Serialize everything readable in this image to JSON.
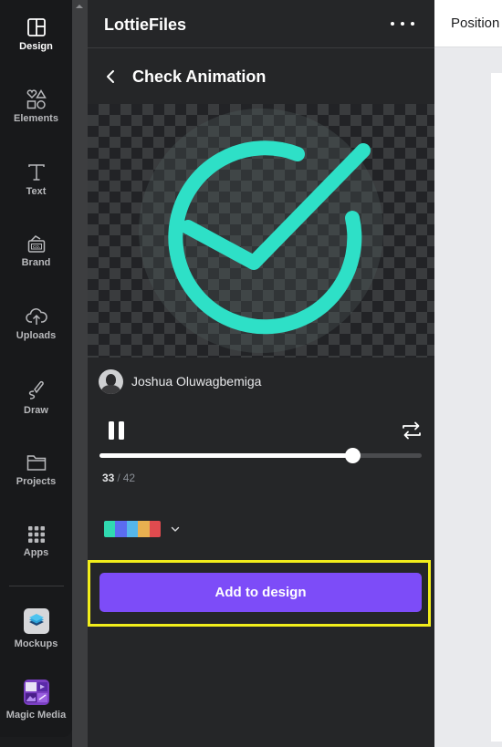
{
  "nav": {
    "items": [
      {
        "label": "Design",
        "icon": "layout-icon",
        "active": true
      },
      {
        "label": "Elements",
        "icon": "shapes-icon",
        "active": false
      },
      {
        "label": "Text",
        "icon": "text-icon",
        "active": false
      },
      {
        "label": "Brand",
        "icon": "brand-kit-icon",
        "active": false
      },
      {
        "label": "Uploads",
        "icon": "cloud-upload-icon",
        "active": false
      },
      {
        "label": "Draw",
        "icon": "pen-icon",
        "active": false
      },
      {
        "label": "Projects",
        "icon": "folder-icon",
        "active": false
      },
      {
        "label": "Apps",
        "icon": "apps-grid-icon",
        "active": false
      },
      {
        "label": "Mockups",
        "icon": "mockups-app-icon",
        "active": false
      },
      {
        "label": "Magic Media",
        "icon": "magic-media-app-icon",
        "active": false
      }
    ]
  },
  "panel": {
    "title": "LottieFiles",
    "more_icon": "more-horizontal-icon",
    "back_icon": "chevron-left-icon",
    "animation_title": "Check Animation",
    "preview": {
      "stroke_color": "#2ee0c7",
      "description": "circle with check mark"
    },
    "author": {
      "name": "Joshua Oluwagbemiga"
    },
    "player": {
      "state": "playing",
      "pause_icon": "pause-icon",
      "loop_icon": "loop-icon",
      "current_frame": "33",
      "separator": "/",
      "total_frames": "42",
      "progress_fraction": 0.786
    },
    "palette": {
      "colors": [
        "#30d9b0",
        "#5b6cf0",
        "#55b6ea",
        "#e8b050",
        "#e04b4f"
      ],
      "chevron_icon": "chevron-down-icon"
    },
    "add_button": "Add to design"
  },
  "canvas": {
    "toolbar_label": "Position"
  },
  "colors": {
    "accent": "#7d4cf8",
    "highlight": "#f2ee1b"
  }
}
